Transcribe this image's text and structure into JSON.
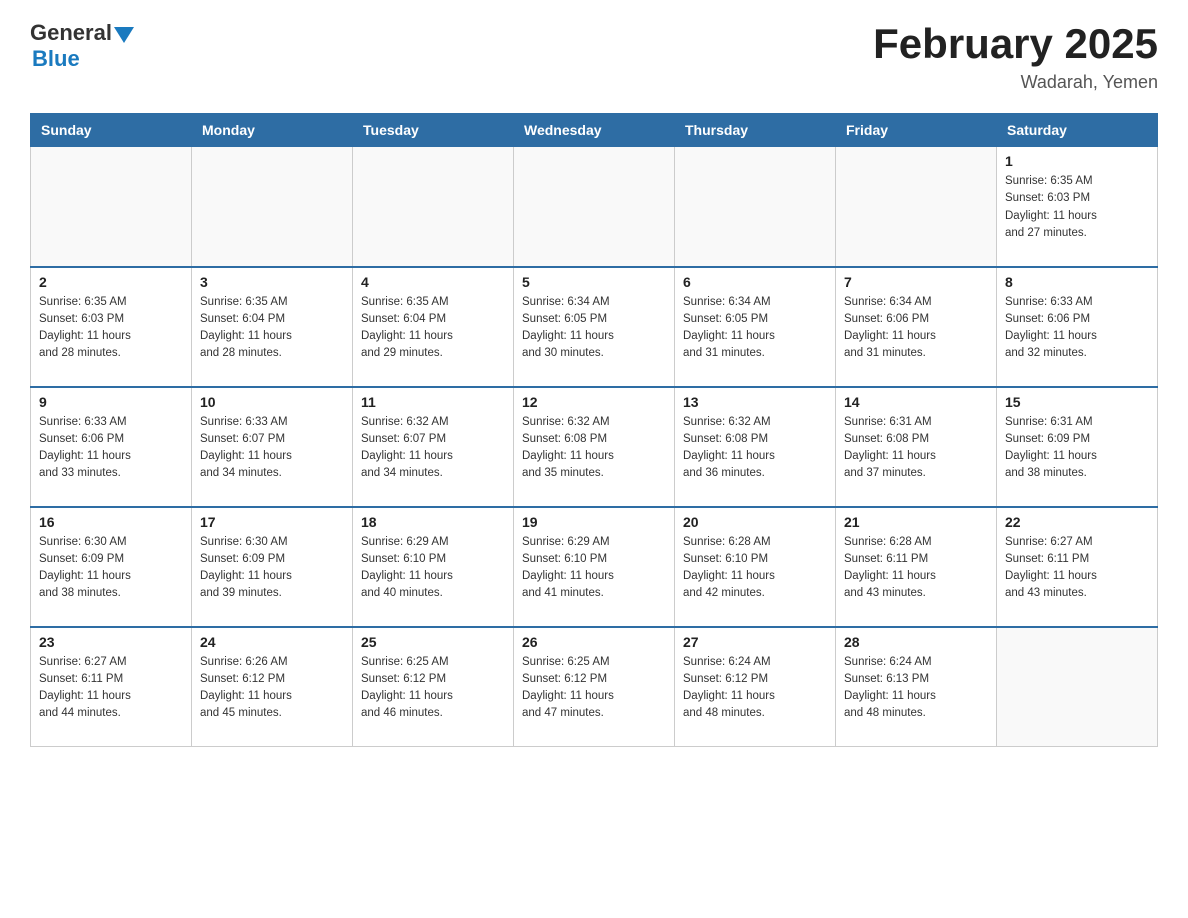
{
  "header": {
    "logo_general": "General",
    "logo_blue": "Blue",
    "month_year": "February 2025",
    "location": "Wadarah, Yemen"
  },
  "weekdays": [
    "Sunday",
    "Monday",
    "Tuesday",
    "Wednesday",
    "Thursday",
    "Friday",
    "Saturday"
  ],
  "weeks": [
    [
      {
        "day": "",
        "info": ""
      },
      {
        "day": "",
        "info": ""
      },
      {
        "day": "",
        "info": ""
      },
      {
        "day": "",
        "info": ""
      },
      {
        "day": "",
        "info": ""
      },
      {
        "day": "",
        "info": ""
      },
      {
        "day": "1",
        "info": "Sunrise: 6:35 AM\nSunset: 6:03 PM\nDaylight: 11 hours\nand 27 minutes."
      }
    ],
    [
      {
        "day": "2",
        "info": "Sunrise: 6:35 AM\nSunset: 6:03 PM\nDaylight: 11 hours\nand 28 minutes."
      },
      {
        "day": "3",
        "info": "Sunrise: 6:35 AM\nSunset: 6:04 PM\nDaylight: 11 hours\nand 28 minutes."
      },
      {
        "day": "4",
        "info": "Sunrise: 6:35 AM\nSunset: 6:04 PM\nDaylight: 11 hours\nand 29 minutes."
      },
      {
        "day": "5",
        "info": "Sunrise: 6:34 AM\nSunset: 6:05 PM\nDaylight: 11 hours\nand 30 minutes."
      },
      {
        "day": "6",
        "info": "Sunrise: 6:34 AM\nSunset: 6:05 PM\nDaylight: 11 hours\nand 31 minutes."
      },
      {
        "day": "7",
        "info": "Sunrise: 6:34 AM\nSunset: 6:06 PM\nDaylight: 11 hours\nand 31 minutes."
      },
      {
        "day": "8",
        "info": "Sunrise: 6:33 AM\nSunset: 6:06 PM\nDaylight: 11 hours\nand 32 minutes."
      }
    ],
    [
      {
        "day": "9",
        "info": "Sunrise: 6:33 AM\nSunset: 6:06 PM\nDaylight: 11 hours\nand 33 minutes."
      },
      {
        "day": "10",
        "info": "Sunrise: 6:33 AM\nSunset: 6:07 PM\nDaylight: 11 hours\nand 34 minutes."
      },
      {
        "day": "11",
        "info": "Sunrise: 6:32 AM\nSunset: 6:07 PM\nDaylight: 11 hours\nand 34 minutes."
      },
      {
        "day": "12",
        "info": "Sunrise: 6:32 AM\nSunset: 6:08 PM\nDaylight: 11 hours\nand 35 minutes."
      },
      {
        "day": "13",
        "info": "Sunrise: 6:32 AM\nSunset: 6:08 PM\nDaylight: 11 hours\nand 36 minutes."
      },
      {
        "day": "14",
        "info": "Sunrise: 6:31 AM\nSunset: 6:08 PM\nDaylight: 11 hours\nand 37 minutes."
      },
      {
        "day": "15",
        "info": "Sunrise: 6:31 AM\nSunset: 6:09 PM\nDaylight: 11 hours\nand 38 minutes."
      }
    ],
    [
      {
        "day": "16",
        "info": "Sunrise: 6:30 AM\nSunset: 6:09 PM\nDaylight: 11 hours\nand 38 minutes."
      },
      {
        "day": "17",
        "info": "Sunrise: 6:30 AM\nSunset: 6:09 PM\nDaylight: 11 hours\nand 39 minutes."
      },
      {
        "day": "18",
        "info": "Sunrise: 6:29 AM\nSunset: 6:10 PM\nDaylight: 11 hours\nand 40 minutes."
      },
      {
        "day": "19",
        "info": "Sunrise: 6:29 AM\nSunset: 6:10 PM\nDaylight: 11 hours\nand 41 minutes."
      },
      {
        "day": "20",
        "info": "Sunrise: 6:28 AM\nSunset: 6:10 PM\nDaylight: 11 hours\nand 42 minutes."
      },
      {
        "day": "21",
        "info": "Sunrise: 6:28 AM\nSunset: 6:11 PM\nDaylight: 11 hours\nand 43 minutes."
      },
      {
        "day": "22",
        "info": "Sunrise: 6:27 AM\nSunset: 6:11 PM\nDaylight: 11 hours\nand 43 minutes."
      }
    ],
    [
      {
        "day": "23",
        "info": "Sunrise: 6:27 AM\nSunset: 6:11 PM\nDaylight: 11 hours\nand 44 minutes."
      },
      {
        "day": "24",
        "info": "Sunrise: 6:26 AM\nSunset: 6:12 PM\nDaylight: 11 hours\nand 45 minutes."
      },
      {
        "day": "25",
        "info": "Sunrise: 6:25 AM\nSunset: 6:12 PM\nDaylight: 11 hours\nand 46 minutes."
      },
      {
        "day": "26",
        "info": "Sunrise: 6:25 AM\nSunset: 6:12 PM\nDaylight: 11 hours\nand 47 minutes."
      },
      {
        "day": "27",
        "info": "Sunrise: 6:24 AM\nSunset: 6:12 PM\nDaylight: 11 hours\nand 48 minutes."
      },
      {
        "day": "28",
        "info": "Sunrise: 6:24 AM\nSunset: 6:13 PM\nDaylight: 11 hours\nand 48 minutes."
      },
      {
        "day": "",
        "info": ""
      }
    ]
  ]
}
